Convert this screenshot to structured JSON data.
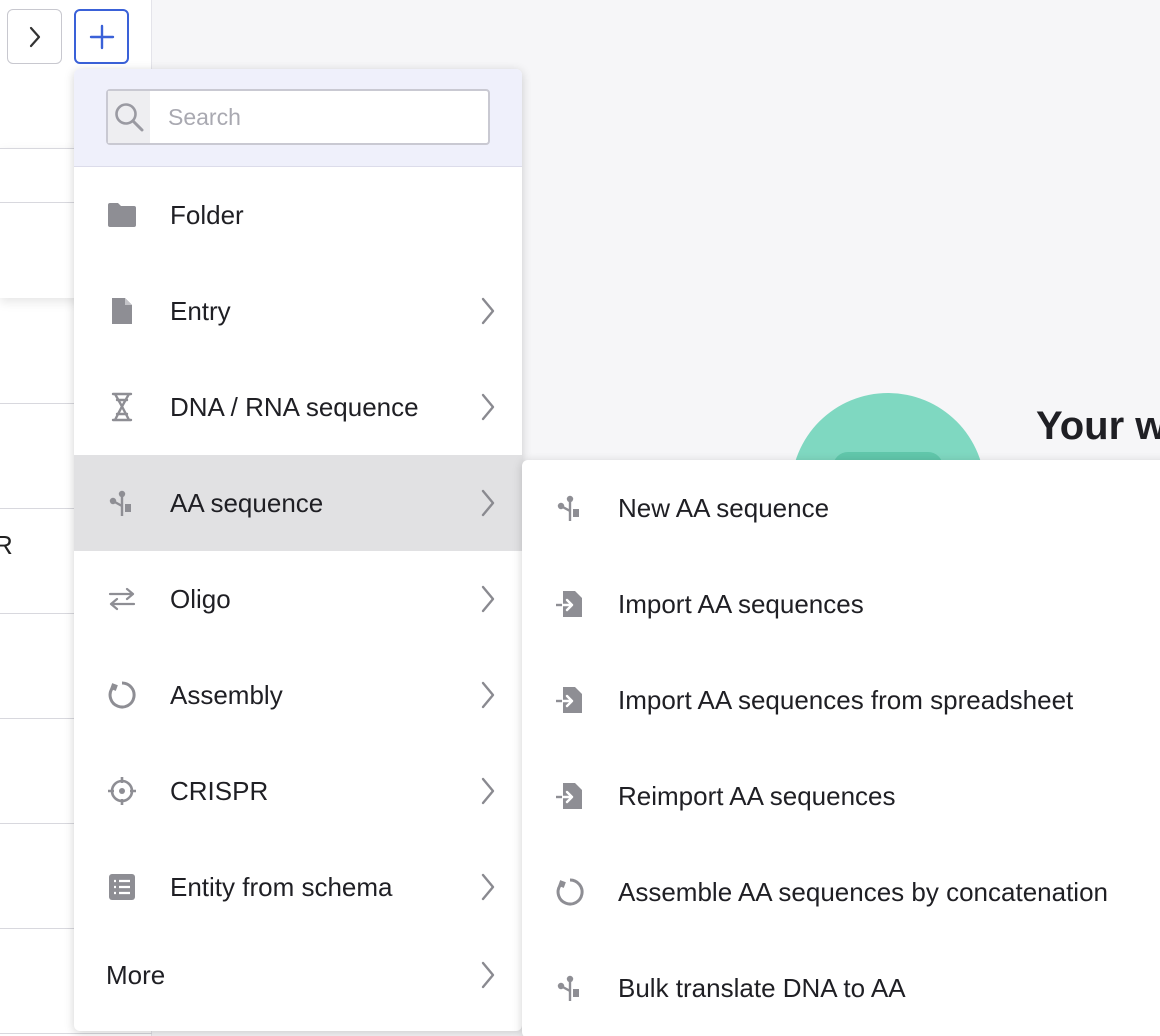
{
  "toolbar": {
    "expand_icon": "chevron-right-icon",
    "add_icon": "plus-icon",
    "accent_color": "#3a61d8"
  },
  "background": {
    "hero_title": "Your w",
    "left_panel_fragment": "R",
    "hero_color": "#7fd8c1"
  },
  "create_menu": {
    "search": {
      "placeholder": "Search",
      "value": ""
    },
    "items": [
      {
        "label": "Folder",
        "icon": "folder-icon",
        "has_submenu": false
      },
      {
        "label": "Entry",
        "icon": "file-icon",
        "has_submenu": true
      },
      {
        "label": "DNA / RNA sequence",
        "icon": "dna-helix-icon",
        "has_submenu": true
      },
      {
        "label": "AA sequence",
        "icon": "aa-sequence-icon",
        "has_submenu": true,
        "active": true
      },
      {
        "label": "Oligo",
        "icon": "swap-arrows-icon",
        "has_submenu": true
      },
      {
        "label": "Assembly",
        "icon": "circular-assembly-icon",
        "has_submenu": true
      },
      {
        "label": "CRISPR",
        "icon": "crosshair-icon",
        "has_submenu": true
      },
      {
        "label": "Entity from schema",
        "icon": "schema-list-icon",
        "has_submenu": true
      },
      {
        "label": "More",
        "icon": "",
        "has_submenu": true
      }
    ],
    "active_background": "#e1e1e3"
  },
  "aa_submenu": {
    "items": [
      {
        "label": "New AA sequence",
        "icon": "aa-sequence-icon"
      },
      {
        "label": "Import AA sequences",
        "icon": "import-file-icon"
      },
      {
        "label": "Import AA sequences from spreadsheet",
        "icon": "import-file-icon"
      },
      {
        "label": "Reimport AA sequences",
        "icon": "import-file-icon"
      },
      {
        "label": "Assemble AA sequences by concatenation",
        "icon": "circular-assembly-icon"
      },
      {
        "label": "Bulk translate DNA to AA",
        "icon": "aa-sequence-icon"
      }
    ]
  }
}
